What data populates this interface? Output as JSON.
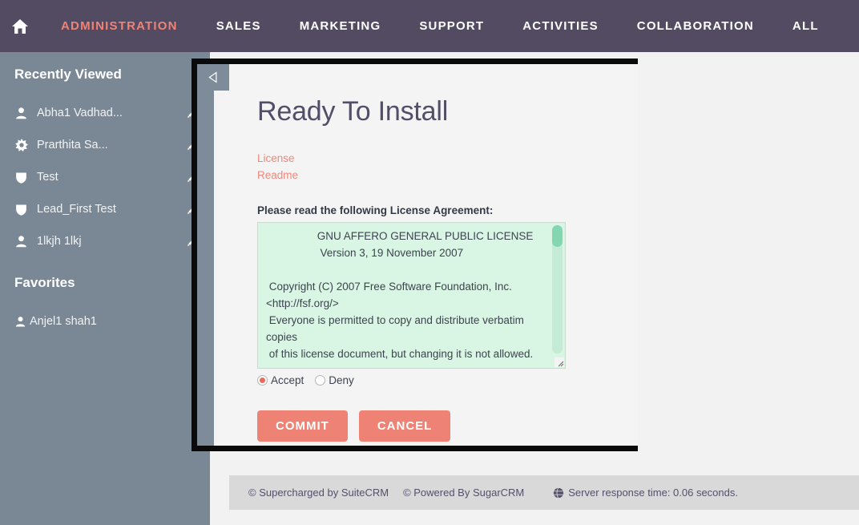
{
  "navbar": {
    "home_icon": "home-icon",
    "items": [
      {
        "label": "ADMINISTRATION",
        "active": true
      },
      {
        "label": "SALES",
        "active": false
      },
      {
        "label": "MARKETING",
        "active": false
      },
      {
        "label": "SUPPORT",
        "active": false
      },
      {
        "label": "ACTIVITIES",
        "active": false
      },
      {
        "label": "COLLABORATION",
        "active": false
      },
      {
        "label": "ALL",
        "active": false
      }
    ],
    "bg_color": "#534b62",
    "active_color": "#f08377"
  },
  "sidebar": {
    "bg_color": "#7a8794",
    "recently_viewed_heading": "Recently Viewed",
    "recently_viewed": [
      {
        "label": "Abha1 Vadhad...",
        "icon": "user-icon",
        "edit_icon": "pencil-icon"
      },
      {
        "label": "Prarthita Sa...",
        "icon": "star-icon",
        "edit_icon": "pencil-icon"
      },
      {
        "label": "Test",
        "icon": "shield-icon",
        "edit_icon": "pencil-icon"
      },
      {
        "label": "Lead_First Test",
        "icon": "shield-icon",
        "edit_icon": "pencil-icon"
      },
      {
        "label": "1lkjh 1lkj",
        "icon": "user-icon",
        "edit_icon": "pencil-icon"
      }
    ],
    "favorites_heading": "Favorites",
    "favorites": [
      {
        "label": "Anjel1 shah1",
        "icon": "user-icon"
      }
    ]
  },
  "modal": {
    "back_icon": "back-triangle-icon",
    "title": "Ready To Install",
    "links": [
      {
        "label": "License"
      },
      {
        "label": "Readme"
      }
    ],
    "agreement_label": "Please read the following License Agreement:",
    "license_text": "                 GNU AFFERO GENERAL PUBLIC LICENSE\n                  Version 3, 19 November 2007\n\n Copyright (C) 2007 Free Software Foundation, Inc. <http://fsf.org/>\n Everyone is permitted to copy and distribute verbatim copies\n of this license document, but changing it is not allowed.",
    "radios": [
      {
        "label": "Accept",
        "selected": true
      },
      {
        "label": "Deny",
        "selected": false
      }
    ],
    "buttons": [
      {
        "label": "COMMIT"
      },
      {
        "label": "CANCEL"
      }
    ],
    "accent_color": "#ee8275",
    "textarea_bg": "#d9f5e4"
  },
  "footer": {
    "supercharged": "© Supercharged by SuiteCRM",
    "powered": "© Powered By SugarCRM",
    "globe_icon": "globe-icon",
    "server_time": "Server response time: 0.06 seconds."
  }
}
